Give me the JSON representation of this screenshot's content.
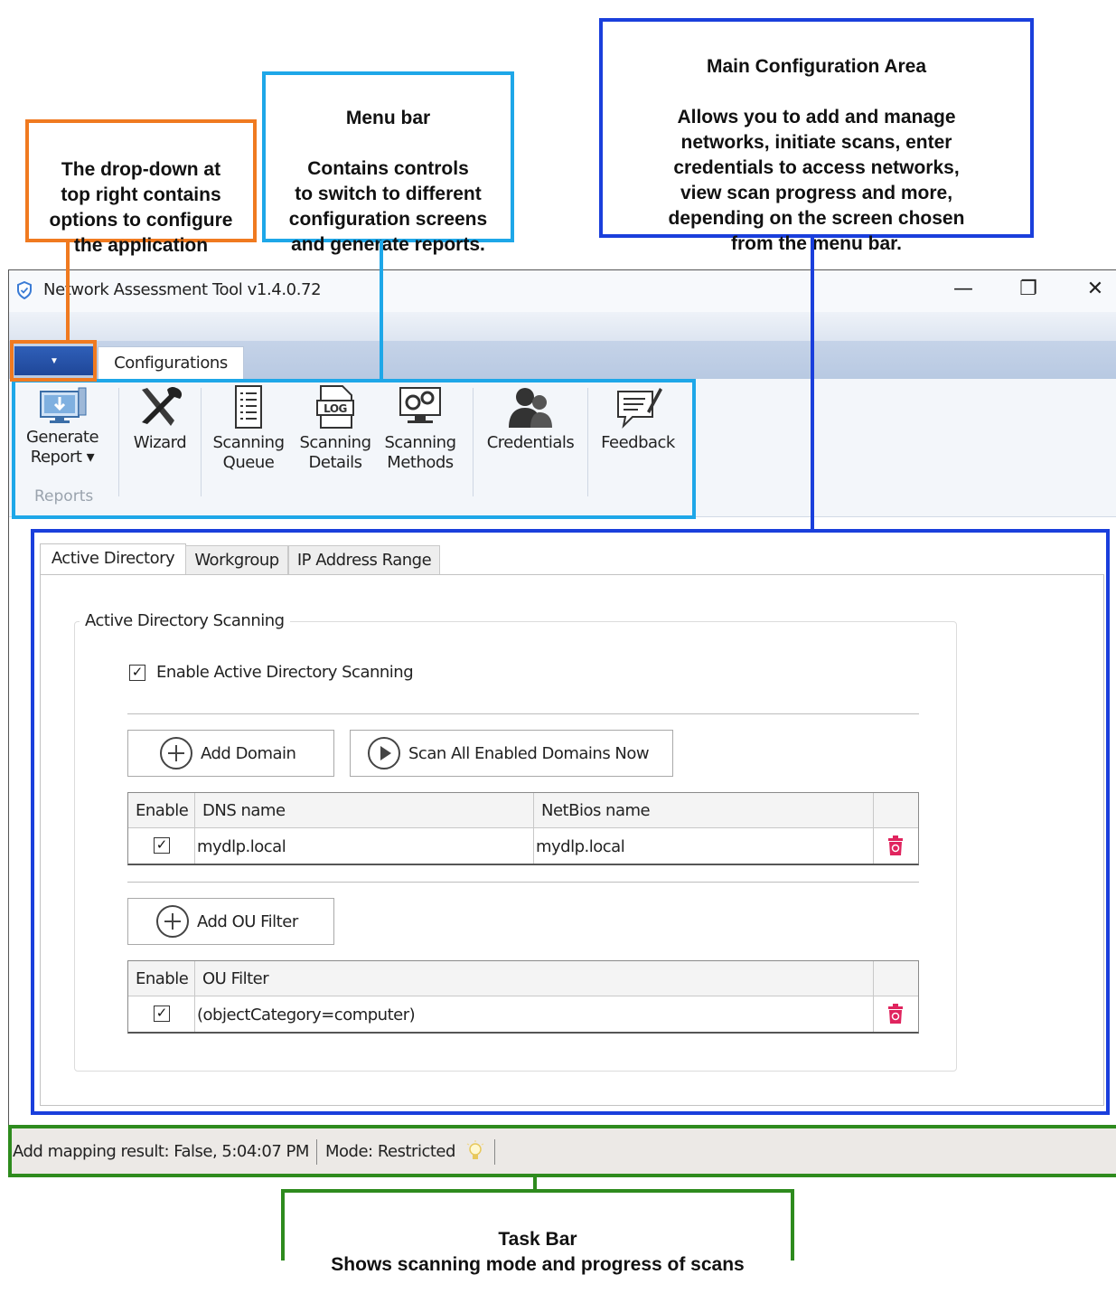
{
  "callouts": {
    "dropdown": "The drop-down at\ntop right contains\noptions to configure\nthe application",
    "menubar": "Menu bar\n\nContains controls\nto switch to different\nconfiguration screens\nand generate reports.",
    "main": "Main Configuration Area\n\nAllows you to add and manage\nnetworks, initiate scans, enter\ncredentials to access networks,\nview scan progress and more,\ndepending on the screen chosen\nfrom the menu bar.",
    "taskbar": "Task Bar\nShows scanning mode and progress of scans"
  },
  "colors": {
    "dropdown": "#f07a20",
    "menubar": "#1ea7e8",
    "main": "#1a3fdc",
    "taskbar": "#2e8b1e"
  },
  "window": {
    "title": "Network Assessment Tool v1.4.0.72",
    "minimize": "—",
    "restore": "❐",
    "close": "✕",
    "app_menu_arrow": "▼"
  },
  "ribbon": {
    "tab": "Configurations",
    "group_label": "Reports",
    "buttons": [
      {
        "label": "Generate\nReport ▾",
        "icon": "monitor-download-icon"
      },
      {
        "label": "Wizard",
        "icon": "tools-icon"
      },
      {
        "label": "Scanning\nQueue",
        "icon": "list-document-icon"
      },
      {
        "label": "Scanning\nDetails",
        "icon": "log-file-icon"
      },
      {
        "label": "Scanning\nMethods",
        "icon": "gears-monitor-icon"
      },
      {
        "label": "Credentials",
        "icon": "users-icon"
      },
      {
        "label": "Feedback",
        "icon": "feedback-icon"
      }
    ]
  },
  "tabs": [
    "Active Directory",
    "Workgroup",
    "IP Address Range"
  ],
  "ad": {
    "group_title": "Active Directory Scanning",
    "enable_label": "Enable Active Directory Scanning",
    "add_domain": "Add Domain",
    "scan_all": "Scan All Enabled Domains Now",
    "domain_grid": {
      "headers": [
        "Enable",
        "DNS name",
        "NetBios name"
      ],
      "rows": [
        {
          "enabled": "✓",
          "dns": "mydlp.local",
          "netbios": "mydlp.local"
        }
      ]
    },
    "add_ou": "Add OU Filter",
    "ou_grid": {
      "headers": [
        "Enable",
        "OU Filter"
      ],
      "rows": [
        {
          "enabled": "✓",
          "filter": "(objectCategory=computer)"
        }
      ]
    }
  },
  "status": {
    "result": "Add mapping result: False, 5:04:07 PM",
    "mode": "Mode: Restricted"
  }
}
